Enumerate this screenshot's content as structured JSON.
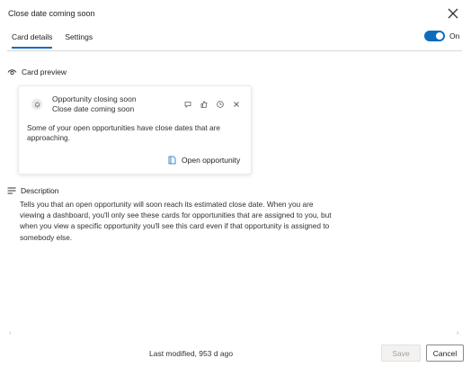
{
  "dialog": {
    "title": "Close date coming soon",
    "close_icon": "close-icon"
  },
  "tabs": [
    {
      "label": "Card details",
      "active": true
    },
    {
      "label": "Settings",
      "active": false
    }
  ],
  "toggle": {
    "label": "On",
    "state": true,
    "color": "#0f6cbd"
  },
  "preview": {
    "heading": "Card preview",
    "icon": "eye-icon",
    "card": {
      "avatar_icon": "bell-icon",
      "title": "Opportunity closing soon",
      "subtitle": "Close date coming soon",
      "action_icons": [
        "chat-icon",
        "thumbs-up-icon",
        "clock-icon",
        "close-icon"
      ],
      "body": "Some of your open opportunities have close dates that are approaching.",
      "action_label": "Open opportunity",
      "action_icon": "document-icon"
    }
  },
  "description": {
    "heading": "Description",
    "icon": "lines-icon",
    "text": "Tells you that an open opportunity will soon reach its estimated close date. When you are viewing a dashboard, you'll only see these cards for opportunities that are assigned to you, but when you view a specific opportunity you'll see this card even if that opportunity is assigned to somebody else."
  },
  "footer": {
    "last_modified": "Last modified, 953 d ago",
    "save_label": "Save",
    "cancel_label": "Cancel"
  },
  "scroll": {
    "left": "‹",
    "right": "›"
  }
}
